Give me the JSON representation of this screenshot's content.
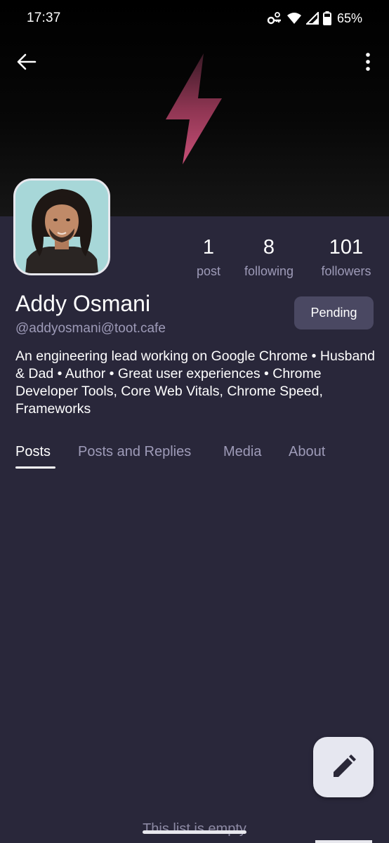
{
  "status_bar": {
    "time": "17:37",
    "battery": "65%",
    "icons": [
      "vpn-key-icon",
      "wifi-icon",
      "signal-icon",
      "battery-icon"
    ]
  },
  "toolbar": {
    "back_icon": "arrow-left-icon",
    "more_icon": "more-vertical-icon"
  },
  "header": {
    "art_icon": "lightning-bolt-icon",
    "art_color": "#c0496e"
  },
  "profile": {
    "display_name": "Addy Osmani",
    "handle": "@addyosmani@toot.cafe",
    "bio": "An engineering lead working on Google Chrome • Husband & Dad • Author • Great user experiences • Chrome Developer Tools, Core Web Vitals, Chrome Speed, Frameworks",
    "follow_button_label": "Pending"
  },
  "stats": {
    "posts": {
      "count": "1",
      "label": "post"
    },
    "following": {
      "count": "8",
      "label": "following"
    },
    "followers": {
      "count": "101",
      "label": "followers"
    }
  },
  "tabs": [
    {
      "label": "Posts",
      "active": true
    },
    {
      "label": "Posts and Replies",
      "active": false
    },
    {
      "label": "Media",
      "active": false
    },
    {
      "label": "About",
      "active": false
    }
  ],
  "content": {
    "empty_message": "This list is empty"
  },
  "fab": {
    "icon": "pencil-icon"
  },
  "colors": {
    "background": "#29273a",
    "muted_text": "#9e9bb8",
    "button_bg": "#4a4862",
    "fab_bg": "#e6e7f0"
  }
}
